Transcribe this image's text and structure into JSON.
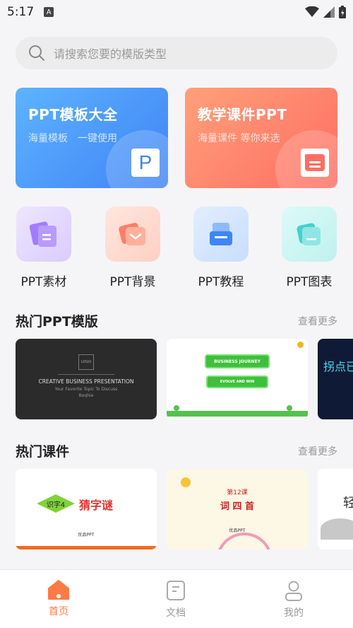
{
  "status": {
    "time": "5:17",
    "notif_letter": "A"
  },
  "search": {
    "placeholder": "请搜索您要的模版类型"
  },
  "banners": [
    {
      "title": "PPT模板大全",
      "subtitle": "海量模板　一键使用",
      "icon_letter": "P"
    },
    {
      "title": "教学课件PPT",
      "subtitle": "海量课件 等你来选"
    }
  ],
  "categories": [
    {
      "label": "PPT素材"
    },
    {
      "label": "PPT背景"
    },
    {
      "label": "PPT教程"
    },
    {
      "label": "PPT图表"
    }
  ],
  "hot_templates": {
    "title": "热门PPT模版",
    "more": "查看更多",
    "cards": [
      {
        "logo": "LOGO",
        "heading": "CREATIVE BUSINESS PRESENTATION",
        "line1": "Your Favorite Topic To Discuss",
        "line2": "Beqhie"
      },
      {
        "banner1": "BUSINESS JOURNEY",
        "banner2": "EVOLVE AND WIN"
      },
      {
        "text": "拐点已至"
      }
    ]
  },
  "hot_courseware": {
    "title": "热门课件",
    "more": "查看更多",
    "cards": [
      {
        "tag": "识字4",
        "title": "猜字谜",
        "footer": "优品PPT"
      },
      {
        "lesson": "第12课",
        "title": "词 四 首",
        "footer": "优品PPT"
      },
      {
        "text": "轻"
      }
    ]
  },
  "nav": [
    {
      "label": "首页",
      "active": true
    },
    {
      "label": "文档",
      "active": false
    },
    {
      "label": "我的",
      "active": false
    }
  ],
  "colors": {
    "accent": "#ff7a45",
    "blue": "#3f83f5",
    "coral": "#ff6d62"
  }
}
